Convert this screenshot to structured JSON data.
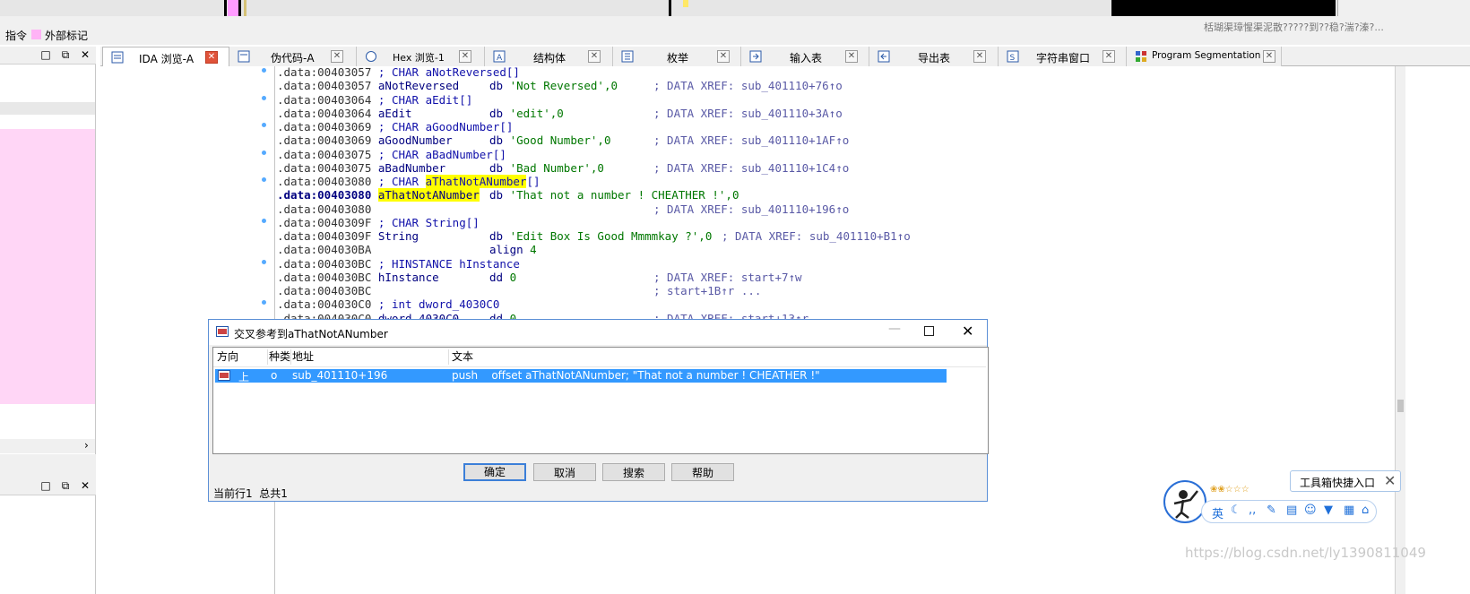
{
  "legend": {
    "instruction_label": "指令",
    "external_label": "外部标记"
  },
  "top_right_garble": "栝瑚渠璋惺渠泥散?????到??稳?湍?溱?...",
  "tabs": [
    {
      "label": "IDA 浏览-A",
      "active": true,
      "icon": "ida-view-icon"
    },
    {
      "label": "伪代码-A",
      "active": false,
      "icon": "pseudocode-icon"
    },
    {
      "label": "Hex 浏览-1",
      "active": false,
      "icon": "hex-view-icon"
    },
    {
      "label": "结构体",
      "active": false,
      "icon": "structures-icon"
    },
    {
      "label": "枚举",
      "active": false,
      "icon": "enums-icon"
    },
    {
      "label": "输入表",
      "active": false,
      "icon": "imports-icon"
    },
    {
      "label": "导出表",
      "active": false,
      "icon": "exports-icon"
    },
    {
      "label": "字符串窗口",
      "active": false,
      "icon": "strings-icon"
    },
    {
      "label": "Program Segmentation",
      "active": false,
      "icon": "segmentation-icon"
    }
  ],
  "code_lines": [
    {
      "addr": ".data:00403057",
      "name": "",
      "op": "",
      "arg": "",
      "comment": "; CHAR aNotReversed[]",
      "xref": "",
      "dot": true
    },
    {
      "addr": ".data:00403057",
      "name": "aNotReversed",
      "op": "db",
      "arg": "'Not Reversed',0",
      "comment": "",
      "xref": "; DATA XREF: sub_401110+76↑o",
      "dot": false
    },
    {
      "addr": ".data:00403064",
      "name": "",
      "op": "",
      "arg": "",
      "comment": "; CHAR aEdit[]",
      "xref": "",
      "dot": true
    },
    {
      "addr": ".data:00403064",
      "name": "aEdit",
      "op": "db",
      "arg": "'edit',0",
      "comment": "",
      "xref": "; DATA XREF: sub_401110+3A↑o",
      "dot": false
    },
    {
      "addr": ".data:00403069",
      "name": "",
      "op": "",
      "arg": "",
      "comment": "; CHAR aGoodNumber[]",
      "xref": "",
      "dot": true
    },
    {
      "addr": ".data:00403069",
      "name": "aGoodNumber",
      "op": "db",
      "arg": "'Good Number',0",
      "comment": "",
      "xref": "; DATA XREF: sub_401110+1AF↑o",
      "dot": false
    },
    {
      "addr": ".data:00403075",
      "name": "",
      "op": "",
      "arg": "",
      "comment": "; CHAR aBadNumber[]",
      "xref": "",
      "dot": true
    },
    {
      "addr": ".data:00403075",
      "name": "aBadNumber",
      "op": "db",
      "arg": "'Bad Number',0",
      "comment": "",
      "xref": "; DATA XREF: sub_401110+1C4↑o",
      "dot": false
    },
    {
      "addr": ".data:00403080",
      "name": "",
      "op": "",
      "arg": "",
      "comment": "; CHAR aThatNotANumber[]",
      "xref": "",
      "dot": true
    },
    {
      "addr": ".data:00403080",
      "name": "aThatNotANumber",
      "op": "db",
      "arg": "'That not a number ! CHEATHER !',0",
      "comment": "",
      "xref": "",
      "dot": false,
      "current": true
    },
    {
      "addr": ".data:00403080",
      "name": "",
      "op": "",
      "arg": "",
      "comment": "",
      "xref": "; DATA XREF: sub_401110+196↑o",
      "dot": false
    },
    {
      "addr": ".data:0040309F",
      "name": "",
      "op": "",
      "arg": "",
      "comment": "; CHAR String[]",
      "xref": "",
      "dot": true
    },
    {
      "addr": ".data:0040309F",
      "name": "String",
      "op": "db",
      "arg": "'Edit Box Is Good Mmmmkay ?',0",
      "comment": "",
      "xref": "; DATA XREF: sub_401110+B1↑o",
      "dot": false
    },
    {
      "addr": ".data:004030BA",
      "name": "",
      "op": "align",
      "arg": "4",
      "comment": "",
      "xref": "",
      "dot": false
    },
    {
      "addr": ".data:004030BC",
      "name": "",
      "op": "",
      "arg": "",
      "comment": "; HINSTANCE hInstance",
      "xref": "",
      "dot": true
    },
    {
      "addr": ".data:004030BC",
      "name": "hInstance",
      "op": "dd",
      "arg": "0",
      "comment": "",
      "xref": "; DATA XREF: start+7↑w",
      "dot": false
    },
    {
      "addr": ".data:004030BC",
      "name": "",
      "op": "",
      "arg": "",
      "comment": "",
      "xref": "; start+1B↑r ...",
      "dot": false
    },
    {
      "addr": ".data:004030C0",
      "name": "",
      "op": "",
      "arg": "",
      "comment": "; int dword_4030C0",
      "xref": "",
      "dot": true
    },
    {
      "addr": ".data:004030C0",
      "name": "dword_4030C0",
      "op": "dd",
      "arg": "0",
      "comment": "",
      "xref": "; DATA XREF: start+13↑r",
      "dot": false
    }
  ],
  "dialog": {
    "title": "交叉参考到aThatNotANumber",
    "columns": {
      "direction": "方向",
      "type": "种类",
      "address": "地址",
      "text": "文本"
    },
    "row": {
      "direction": "上",
      "type": "o",
      "address": "sub_401110+196",
      "text": "push    offset aThatNotANumber; \"That not a number ! CHEATHER !\""
    },
    "buttons": {
      "ok": "确定",
      "cancel": "取消",
      "search": "搜索",
      "help": "帮助"
    },
    "status": "当前行1  总共1"
  },
  "widget": {
    "toolbox_label": "工具箱快捷入口",
    "ime_label": "英",
    "watermark": "https://blog.csdn.net/ly1390811049"
  },
  "colors": {
    "accent_blue": "#3399ff",
    "highlight_yellow": "#ffff00",
    "pink_pane": "#ffd6f6",
    "dialog_border": "#5b8fd6"
  }
}
